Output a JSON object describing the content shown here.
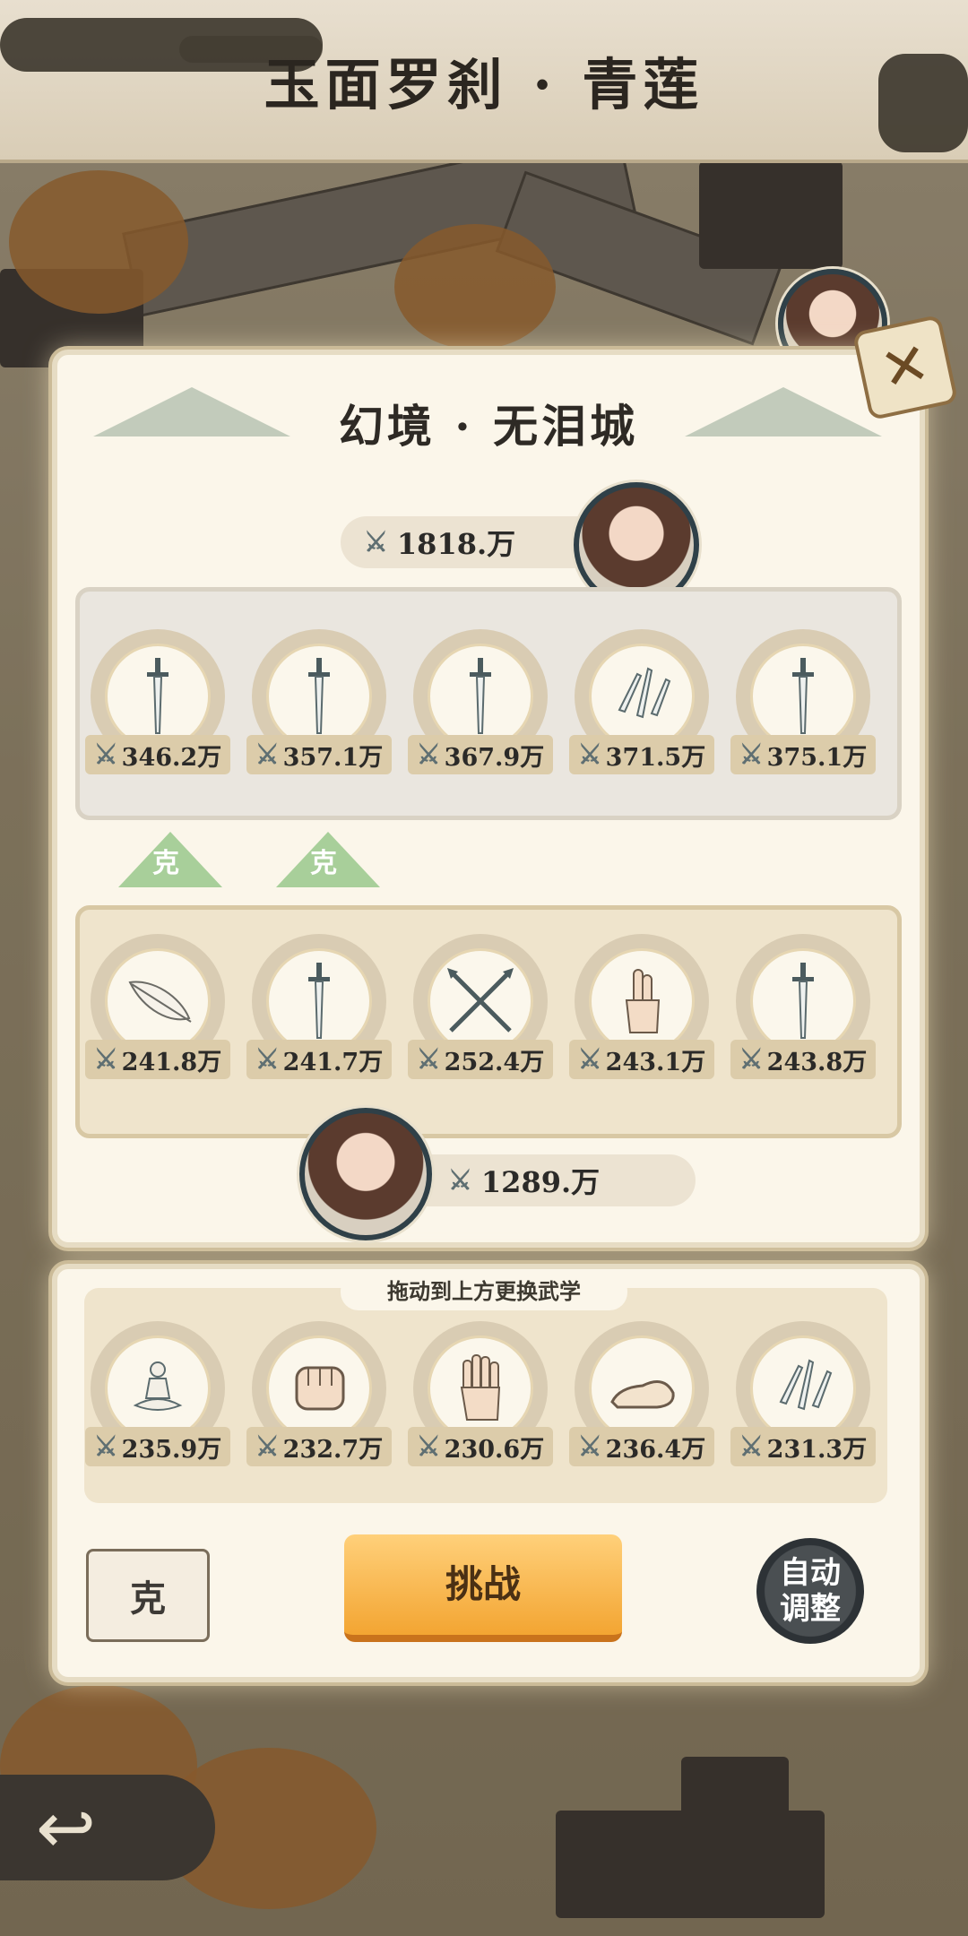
{
  "header": {
    "title": "玉面罗刹 · 青莲"
  },
  "panel": {
    "title": "幻境 · 无泪城",
    "close_icon": "x-close-icon"
  },
  "enemy": {
    "power": "1818.万",
    "weapons": [
      {
        "icon": "sword-icon",
        "power": "346.2万"
      },
      {
        "icon": "sword-icon",
        "power": "357.1万"
      },
      {
        "icon": "sword-icon",
        "power": "367.9万"
      },
      {
        "icon": "throwing-knives-icon",
        "power": "371.5万"
      },
      {
        "icon": "sword-icon",
        "power": "375.1万"
      }
    ]
  },
  "counters": [
    {
      "label": "克"
    },
    {
      "label": "克"
    }
  ],
  "player": {
    "power": "1289.万",
    "weapons": [
      {
        "icon": "feather-icon",
        "power": "241.8万"
      },
      {
        "icon": "sword-icon",
        "power": "241.7万"
      },
      {
        "icon": "crossed-spears-icon",
        "power": "252.4万"
      },
      {
        "icon": "finger-gesture-icon",
        "power": "243.1万"
      },
      {
        "icon": "sword-icon",
        "power": "243.8万"
      }
    ]
  },
  "pool": {
    "label": "拖动到上方更换武学",
    "skills": [
      {
        "icon": "meditation-icon",
        "power": "235.9万"
      },
      {
        "icon": "fist-icon",
        "power": "232.7万"
      },
      {
        "icon": "palm-icon",
        "power": "230.6万"
      },
      {
        "icon": "shoe-icon",
        "power": "236.4万"
      },
      {
        "icon": "throwing-knives-icon",
        "power": "231.3万"
      }
    ]
  },
  "actions": {
    "book_label": "克",
    "challenge_label": "挑战",
    "auto_label_line1": "自动",
    "auto_label_line2": "调整"
  }
}
